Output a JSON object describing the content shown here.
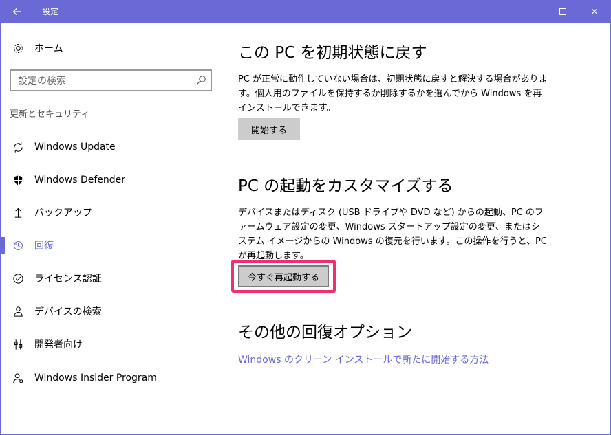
{
  "window": {
    "title": "設定",
    "accent": "#6b69d6",
    "back_icon": "back-arrow-icon",
    "min_icon": "minimize-icon",
    "max_icon": "maximize-icon",
    "close_icon": "close-icon",
    "close_glyph": "✕"
  },
  "sidebar": {
    "home_label": "ホーム",
    "search_placeholder": "設定の検索",
    "section_title": "更新とセキュリティ",
    "items": [
      {
        "label": "Windows Update",
        "icon": "sync-icon"
      },
      {
        "label": "Windows Defender",
        "icon": "shield-icon"
      },
      {
        "label": "バックアップ",
        "icon": "backup-arrow-icon"
      },
      {
        "label": "回復",
        "icon": "history-icon"
      },
      {
        "label": "ライセンス認証",
        "icon": "check-circle-icon"
      },
      {
        "label": "デバイスの検索",
        "icon": "person-location-icon"
      },
      {
        "label": "開発者向け",
        "icon": "developer-tools-icon"
      },
      {
        "label": "Windows Insider Program",
        "icon": "insider-person-icon"
      }
    ],
    "active_index": 3
  },
  "main": {
    "reset": {
      "title": "この PC を初期状態に戻す",
      "description": "PC が正常に動作していない場合は、初期状態に戻すと解決する場合があります。個人用のファイルを保持するか削除するかを選んでから Windows を再インストールできます。",
      "button": "開始する"
    },
    "startup": {
      "title": "PC の起動をカスタマイズする",
      "description": "デバイスまたはディスク (USB ドライブや DVD など) からの起動、PC のファームウェア設定の変更、Windows スタートアップ設定の変更、またはシステム イメージからの Windows の復元を行います。この操作を行うと、PC が再起動します。",
      "button": "今すぐ再起動する",
      "highlight_color": "#f0306e"
    },
    "other": {
      "title": "その他の回復オプション",
      "link": "Windows のクリーン インストールで新たに開始する方法"
    }
  }
}
